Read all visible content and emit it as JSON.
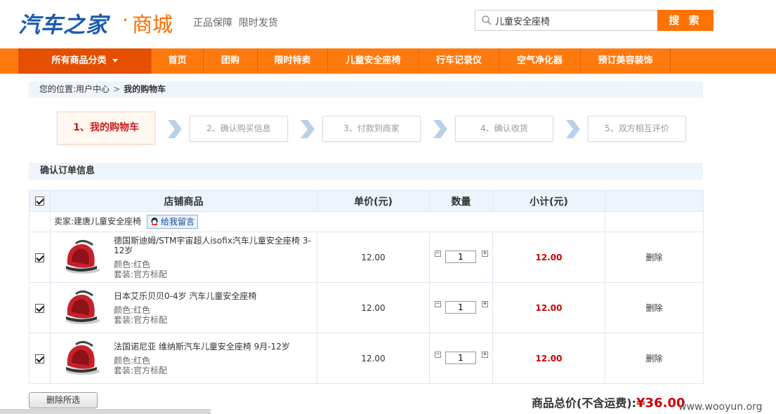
{
  "header": {
    "logo_main": "汽车之家",
    "logo_dot": "·",
    "logo_sub": "商城",
    "slogan": "正品保障  限时发货",
    "search_value": "儿童安全座椅",
    "search_button": "搜 索"
  },
  "nav": {
    "all_categories": "所有商品分类",
    "items": [
      "首页",
      "团购",
      "限时特卖",
      "儿童安全座椅",
      "行车记录仪",
      "空气净化器",
      "预订美容装饰"
    ]
  },
  "breadcrumb": {
    "prefix": "您的位置:",
    "parent": "用户中心",
    "separator": ">",
    "current": "我的购物车"
  },
  "steps": [
    "1、我的购物车",
    "2、确认购买信息",
    "3、付款到商家",
    "4、确认收货",
    "5、双方相互评价"
  ],
  "section_title": "确认订单信息",
  "table": {
    "headers": [
      "店铺商品",
      "单价(元)",
      "数量",
      "小计(元)"
    ],
    "seller_label": "卖家:建唐儿童安全座椅",
    "message_button": "给我留言",
    "items": [
      {
        "title": "德国斯迪姆/STM宇宙超人isofix汽车儿童安全座椅 3-12岁",
        "color": "颜色:红色",
        "package": "套装:官方标配",
        "price": "12.00",
        "qty": "1",
        "subtotal": "12.00",
        "delete": "删除"
      },
      {
        "title": "日本艾乐贝贝0-4岁 汽车儿童安全座椅",
        "color": "颜色:红色",
        "package": "套装:官方标配",
        "price": "12.00",
        "qty": "1",
        "subtotal": "12.00",
        "delete": "删除"
      },
      {
        "title": "法国诺尼亚 维纳斯汽车儿童安全座椅 9月-12岁",
        "color": "颜色:红色",
        "package": "套装:官方标配",
        "price": "12.00",
        "qty": "1",
        "subtotal": "12.00",
        "delete": "删除"
      }
    ]
  },
  "footer": {
    "delete_selected": "删除所选",
    "total_label": "商品总价(不含运费):",
    "total_amount": "¥36.00",
    "watermark": "www.wooyun.org"
  },
  "colors": {
    "brand_blue": "#1a5bb0",
    "brand_orange": "#ff7200",
    "nav_orange": "#ff7a0e",
    "price_red": "#cc0000"
  }
}
